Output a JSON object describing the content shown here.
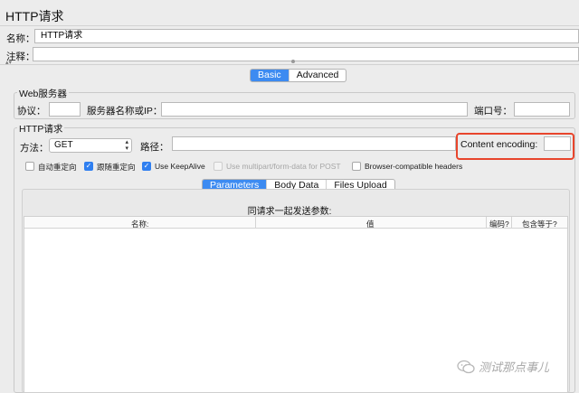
{
  "title": "HTTP请求",
  "name_label": "名称：",
  "name_value": "HTTP请求",
  "comment_label": "注释：",
  "comment_value": "",
  "splitter_glyph": "▴▾",
  "tabs": {
    "basic": "Basic",
    "advanced": "Advanced"
  },
  "web_server": {
    "title": "Web服务器",
    "protocol_label": "协议：",
    "server_label": "服务器名称或IP：",
    "port_label": "端口号："
  },
  "http_request": {
    "title": "HTTP请求",
    "method_label": "方法：",
    "method_value": "GET",
    "path_label": "路径：",
    "encoding_label": "Content encoding:",
    "highlight_color": "#e8452c"
  },
  "checkboxes": [
    {
      "label": "自动重定向",
      "checked": false,
      "disabled": false
    },
    {
      "label": "跟随重定向",
      "checked": true,
      "disabled": false
    },
    {
      "label": "Use KeepAlive",
      "checked": true,
      "disabled": false
    },
    {
      "label": "Use multipart/form-data for POST",
      "checked": false,
      "disabled": true
    },
    {
      "label": "Browser-compatible headers",
      "checked": false,
      "disabled": false
    }
  ],
  "subtabs": {
    "parameters": "Parameters",
    "body_data": "Body Data",
    "files_upload": "Files Upload"
  },
  "params": {
    "caption": "同请求一起发送参数:",
    "columns": {
      "name": "名称:",
      "value": "值",
      "encode": "编码?",
      "include_equals": "包含等于?"
    }
  },
  "watermark": "测试那点事儿",
  "accent_color": "#3d8bf1"
}
